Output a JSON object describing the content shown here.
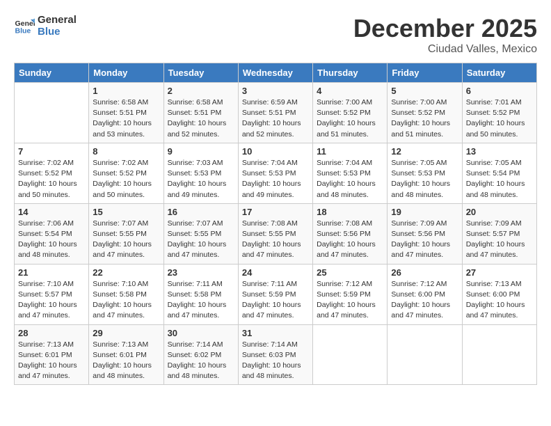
{
  "logo": {
    "text_general": "General",
    "text_blue": "Blue"
  },
  "title": {
    "month_year": "December 2025",
    "location": "Ciudad Valles, Mexico"
  },
  "days_of_week": [
    "Sunday",
    "Monday",
    "Tuesday",
    "Wednesday",
    "Thursday",
    "Friday",
    "Saturday"
  ],
  "weeks": [
    [
      {
        "day": "",
        "info": ""
      },
      {
        "day": "1",
        "info": "Sunrise: 6:58 AM\nSunset: 5:51 PM\nDaylight: 10 hours\nand 53 minutes."
      },
      {
        "day": "2",
        "info": "Sunrise: 6:58 AM\nSunset: 5:51 PM\nDaylight: 10 hours\nand 52 minutes."
      },
      {
        "day": "3",
        "info": "Sunrise: 6:59 AM\nSunset: 5:51 PM\nDaylight: 10 hours\nand 52 minutes."
      },
      {
        "day": "4",
        "info": "Sunrise: 7:00 AM\nSunset: 5:52 PM\nDaylight: 10 hours\nand 51 minutes."
      },
      {
        "day": "5",
        "info": "Sunrise: 7:00 AM\nSunset: 5:52 PM\nDaylight: 10 hours\nand 51 minutes."
      },
      {
        "day": "6",
        "info": "Sunrise: 7:01 AM\nSunset: 5:52 PM\nDaylight: 10 hours\nand 50 minutes."
      }
    ],
    [
      {
        "day": "7",
        "info": "Sunrise: 7:02 AM\nSunset: 5:52 PM\nDaylight: 10 hours\nand 50 minutes."
      },
      {
        "day": "8",
        "info": "Sunrise: 7:02 AM\nSunset: 5:52 PM\nDaylight: 10 hours\nand 50 minutes."
      },
      {
        "day": "9",
        "info": "Sunrise: 7:03 AM\nSunset: 5:53 PM\nDaylight: 10 hours\nand 49 minutes."
      },
      {
        "day": "10",
        "info": "Sunrise: 7:04 AM\nSunset: 5:53 PM\nDaylight: 10 hours\nand 49 minutes."
      },
      {
        "day": "11",
        "info": "Sunrise: 7:04 AM\nSunset: 5:53 PM\nDaylight: 10 hours\nand 48 minutes."
      },
      {
        "day": "12",
        "info": "Sunrise: 7:05 AM\nSunset: 5:53 PM\nDaylight: 10 hours\nand 48 minutes."
      },
      {
        "day": "13",
        "info": "Sunrise: 7:05 AM\nSunset: 5:54 PM\nDaylight: 10 hours\nand 48 minutes."
      }
    ],
    [
      {
        "day": "14",
        "info": "Sunrise: 7:06 AM\nSunset: 5:54 PM\nDaylight: 10 hours\nand 48 minutes."
      },
      {
        "day": "15",
        "info": "Sunrise: 7:07 AM\nSunset: 5:55 PM\nDaylight: 10 hours\nand 47 minutes."
      },
      {
        "day": "16",
        "info": "Sunrise: 7:07 AM\nSunset: 5:55 PM\nDaylight: 10 hours\nand 47 minutes."
      },
      {
        "day": "17",
        "info": "Sunrise: 7:08 AM\nSunset: 5:55 PM\nDaylight: 10 hours\nand 47 minutes."
      },
      {
        "day": "18",
        "info": "Sunrise: 7:08 AM\nSunset: 5:56 PM\nDaylight: 10 hours\nand 47 minutes."
      },
      {
        "day": "19",
        "info": "Sunrise: 7:09 AM\nSunset: 5:56 PM\nDaylight: 10 hours\nand 47 minutes."
      },
      {
        "day": "20",
        "info": "Sunrise: 7:09 AM\nSunset: 5:57 PM\nDaylight: 10 hours\nand 47 minutes."
      }
    ],
    [
      {
        "day": "21",
        "info": "Sunrise: 7:10 AM\nSunset: 5:57 PM\nDaylight: 10 hours\nand 47 minutes."
      },
      {
        "day": "22",
        "info": "Sunrise: 7:10 AM\nSunset: 5:58 PM\nDaylight: 10 hours\nand 47 minutes."
      },
      {
        "day": "23",
        "info": "Sunrise: 7:11 AM\nSunset: 5:58 PM\nDaylight: 10 hours\nand 47 minutes."
      },
      {
        "day": "24",
        "info": "Sunrise: 7:11 AM\nSunset: 5:59 PM\nDaylight: 10 hours\nand 47 minutes."
      },
      {
        "day": "25",
        "info": "Sunrise: 7:12 AM\nSunset: 5:59 PM\nDaylight: 10 hours\nand 47 minutes."
      },
      {
        "day": "26",
        "info": "Sunrise: 7:12 AM\nSunset: 6:00 PM\nDaylight: 10 hours\nand 47 minutes."
      },
      {
        "day": "27",
        "info": "Sunrise: 7:13 AM\nSunset: 6:00 PM\nDaylight: 10 hours\nand 47 minutes."
      }
    ],
    [
      {
        "day": "28",
        "info": "Sunrise: 7:13 AM\nSunset: 6:01 PM\nDaylight: 10 hours\nand 47 minutes."
      },
      {
        "day": "29",
        "info": "Sunrise: 7:13 AM\nSunset: 6:01 PM\nDaylight: 10 hours\nand 48 minutes."
      },
      {
        "day": "30",
        "info": "Sunrise: 7:14 AM\nSunset: 6:02 PM\nDaylight: 10 hours\nand 48 minutes."
      },
      {
        "day": "31",
        "info": "Sunrise: 7:14 AM\nSunset: 6:03 PM\nDaylight: 10 hours\nand 48 minutes."
      },
      {
        "day": "",
        "info": ""
      },
      {
        "day": "",
        "info": ""
      },
      {
        "day": "",
        "info": ""
      }
    ]
  ]
}
